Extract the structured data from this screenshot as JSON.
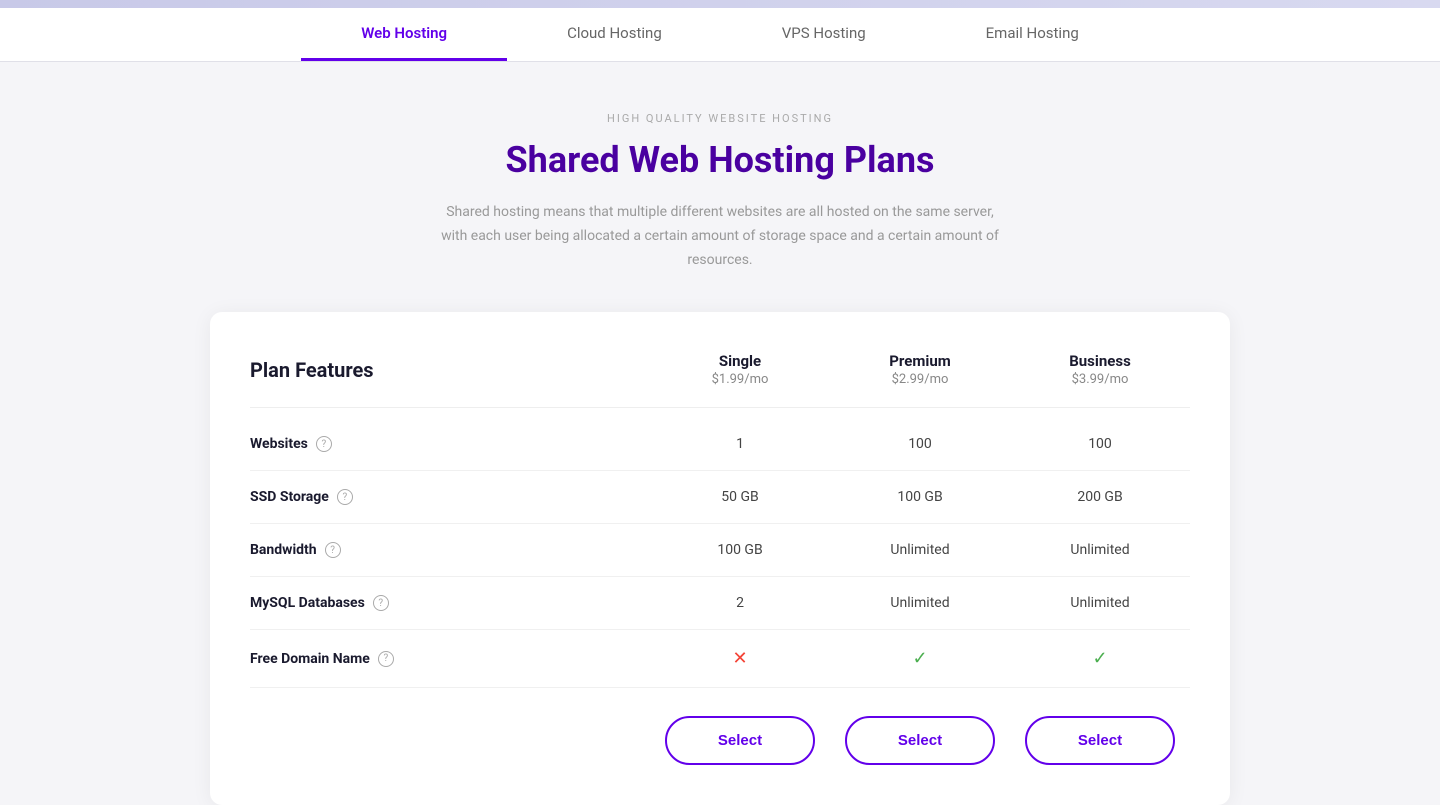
{
  "topBar": {},
  "nav": {
    "tabs": [
      {
        "id": "web",
        "label": "Web Hosting",
        "active": true
      },
      {
        "id": "cloud",
        "label": "Cloud Hosting",
        "active": false
      },
      {
        "id": "vps",
        "label": "VPS Hosting",
        "active": false
      },
      {
        "id": "email",
        "label": "Email Hosting",
        "active": false
      }
    ]
  },
  "header": {
    "subtitle": "HIGH QUALITY WEBSITE HOSTING",
    "title": "Shared Web Hosting Plans",
    "description": "Shared hosting means that multiple different websites are all hosted on the same server, with each user being allocated a certain amount of storage space and a certain amount of resources."
  },
  "comparison": {
    "featuresLabel": "Plan Features",
    "plans": [
      {
        "id": "single",
        "name": "Single",
        "price": "$1.99/mo"
      },
      {
        "id": "premium",
        "name": "Premium",
        "price": "$2.99/mo"
      },
      {
        "id": "business",
        "name": "Business",
        "price": "$3.99/mo"
      }
    ],
    "features": [
      {
        "id": "websites",
        "name": "Websites",
        "hasHelp": true,
        "values": [
          "1",
          "100",
          "100"
        ],
        "types": [
          "text",
          "text",
          "text"
        ]
      },
      {
        "id": "ssd-storage",
        "name": "SSD Storage",
        "hasHelp": true,
        "values": [
          "50 GB",
          "100 GB",
          "200 GB"
        ],
        "types": [
          "text",
          "text",
          "text"
        ]
      },
      {
        "id": "bandwidth",
        "name": "Bandwidth",
        "hasHelp": true,
        "values": [
          "100 GB",
          "Unlimited",
          "Unlimited"
        ],
        "types": [
          "text",
          "text",
          "text"
        ]
      },
      {
        "id": "mysql-databases",
        "name": "MySQL Databases",
        "hasHelp": true,
        "values": [
          "2",
          "Unlimited",
          "Unlimited"
        ],
        "types": [
          "text",
          "text",
          "text"
        ]
      },
      {
        "id": "free-domain",
        "name": "Free Domain Name",
        "hasHelp": true,
        "values": [
          "cross",
          "check",
          "check"
        ],
        "types": [
          "cross",
          "check",
          "check"
        ]
      }
    ],
    "selectLabel": "Select"
  }
}
